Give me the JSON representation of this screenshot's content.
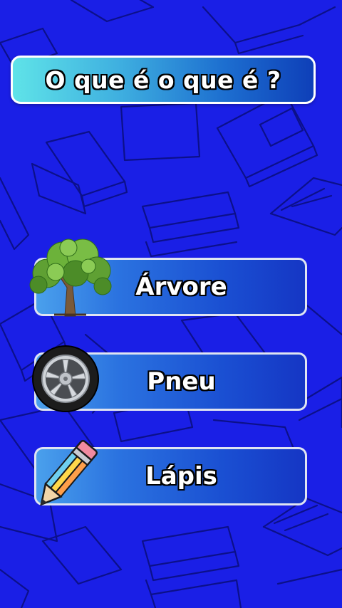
{
  "question": {
    "text": "O que é o que é ?"
  },
  "options": [
    {
      "label": "Árvore",
      "icon": "tree-icon"
    },
    {
      "label": "Pneu",
      "icon": "tire-icon"
    },
    {
      "label": "Lápis",
      "icon": "pencil-icon"
    }
  ],
  "colors": {
    "background": "#1a1fe6",
    "doodle_line": "#0a0e7a",
    "banner_start": "#5fe3e8",
    "banner_end": "#0e3fb8",
    "option_start": "#4aa0ec",
    "option_end": "#1536c4"
  }
}
